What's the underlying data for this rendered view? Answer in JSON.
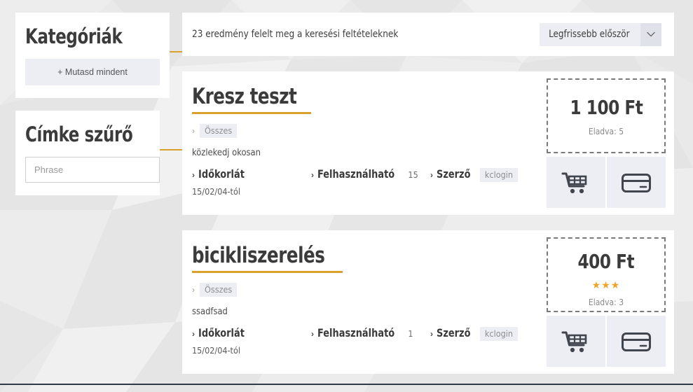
{
  "sidebar": {
    "categories_panel": {
      "title": "Kategóriák",
      "show_all_label": "+ Mutasd mindent"
    },
    "tag_filter_panel": {
      "title": "Címke szűrő",
      "input_placeholder": "Phrase",
      "input_value": ""
    }
  },
  "main": {
    "results_bar": {
      "count_text": "23 eredmény felelt meg a keresési feltételeknek",
      "sort_selected": "Legfrissebb először",
      "sort_caret_icon": "chevron-down-icon"
    },
    "cards": [
      {
        "title": "Kresz teszt",
        "category_chevron": "›",
        "category_badge": "Összes",
        "description": "közlekedj okosan",
        "meta": {
          "time_limit_label": "Időkorlát",
          "time_limit_value": "15/02/04-tól",
          "usable_label": "Felhasználható",
          "usable_value": "15",
          "author_label": "Szerző",
          "author_badge": "kclogin"
        },
        "price": "1 100 Ft",
        "stars": 0,
        "sold_text": "Eladva: 5",
        "actions": {
          "cart_icon": "shopping-cart-icon",
          "card_icon": "credit-card-icon"
        }
      },
      {
        "title": "bicikliszerelés",
        "category_chevron": "›",
        "category_badge": "Összes",
        "description": "ssadfsad",
        "meta": {
          "time_limit_label": "Időkorlát",
          "time_limit_value": "15/02/04-tól",
          "usable_label": "Felhasználható",
          "usable_value": "1",
          "author_label": "Szerző",
          "author_badge": "kclogin"
        },
        "price": "400 Ft",
        "stars": 3,
        "stars_glyphs": "★★★",
        "sold_text": "Eladva: 3",
        "actions": {
          "cart_icon": "shopping-cart-icon",
          "card_icon": "credit-card-icon"
        }
      }
    ]
  },
  "colors": {
    "accent_orange": "#d9a02b",
    "star_orange": "#f0a327",
    "page_bg": "#e8e8e8",
    "panel_bg": "#ffffff",
    "badge_bg": "#eceef3",
    "text_dark": "#3b3b3b"
  }
}
